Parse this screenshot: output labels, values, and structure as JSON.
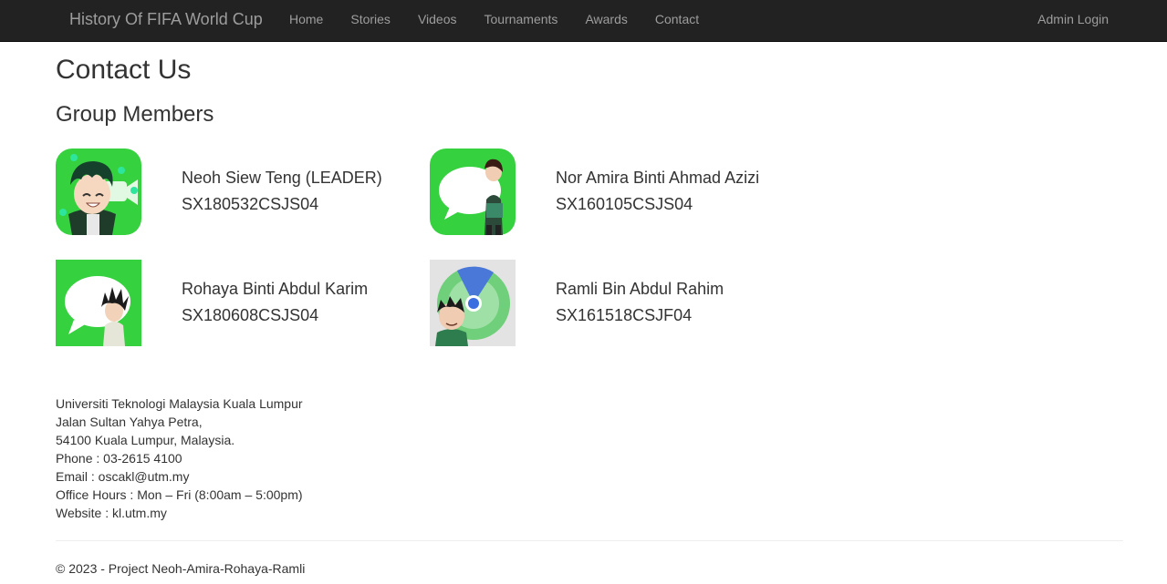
{
  "navbar": {
    "brand": "History Of FIFA World Cup",
    "links": [
      "Home",
      "Stories",
      "Videos",
      "Tournaments",
      "Awards",
      "Contact"
    ],
    "admin": "Admin Login"
  },
  "page": {
    "title": "Contact Us",
    "section_title": "Group Members"
  },
  "members": [
    {
      "name": "Neoh Siew Teng (LEADER)",
      "id": "SX180532CSJS04",
      "photo": "facetime-anime-avatar"
    },
    {
      "name": "Nor Amira Binti Ahmad Azizi",
      "id": "SX160105CSJS04",
      "photo": "messages-anime-avatar"
    },
    {
      "name": "Rohaya Binti Abdul Karim",
      "id": "SX180608CSJS04",
      "photo": "messages-anime-avatar"
    },
    {
      "name": "Ramli Bin Abdul Rahim",
      "id": "SX161518CSJF04",
      "photo": "radar-anime-avatar"
    }
  ],
  "address": {
    "line1": "Universiti Teknologi Malaysia Kuala Lumpur",
    "line2": "Jalan Sultan Yahya Petra,",
    "line3": "54100 Kuala Lumpur, Malaysia.",
    "phone": "Phone : 03-2615 4100",
    "email": "Email : oscakl@utm.my",
    "hours": "Office Hours : Mon – Fri (8:00am – 5:00pm)",
    "website": "Website : kl.utm.my"
  },
  "footer": {
    "copyright": "© 2023 - Project Neoh-Amira-Rohaya-Ramli"
  },
  "colors": {
    "navbar_bg": "#222222",
    "nav_text": "#9d9d9d",
    "icon_green": "#2ecc3a"
  }
}
